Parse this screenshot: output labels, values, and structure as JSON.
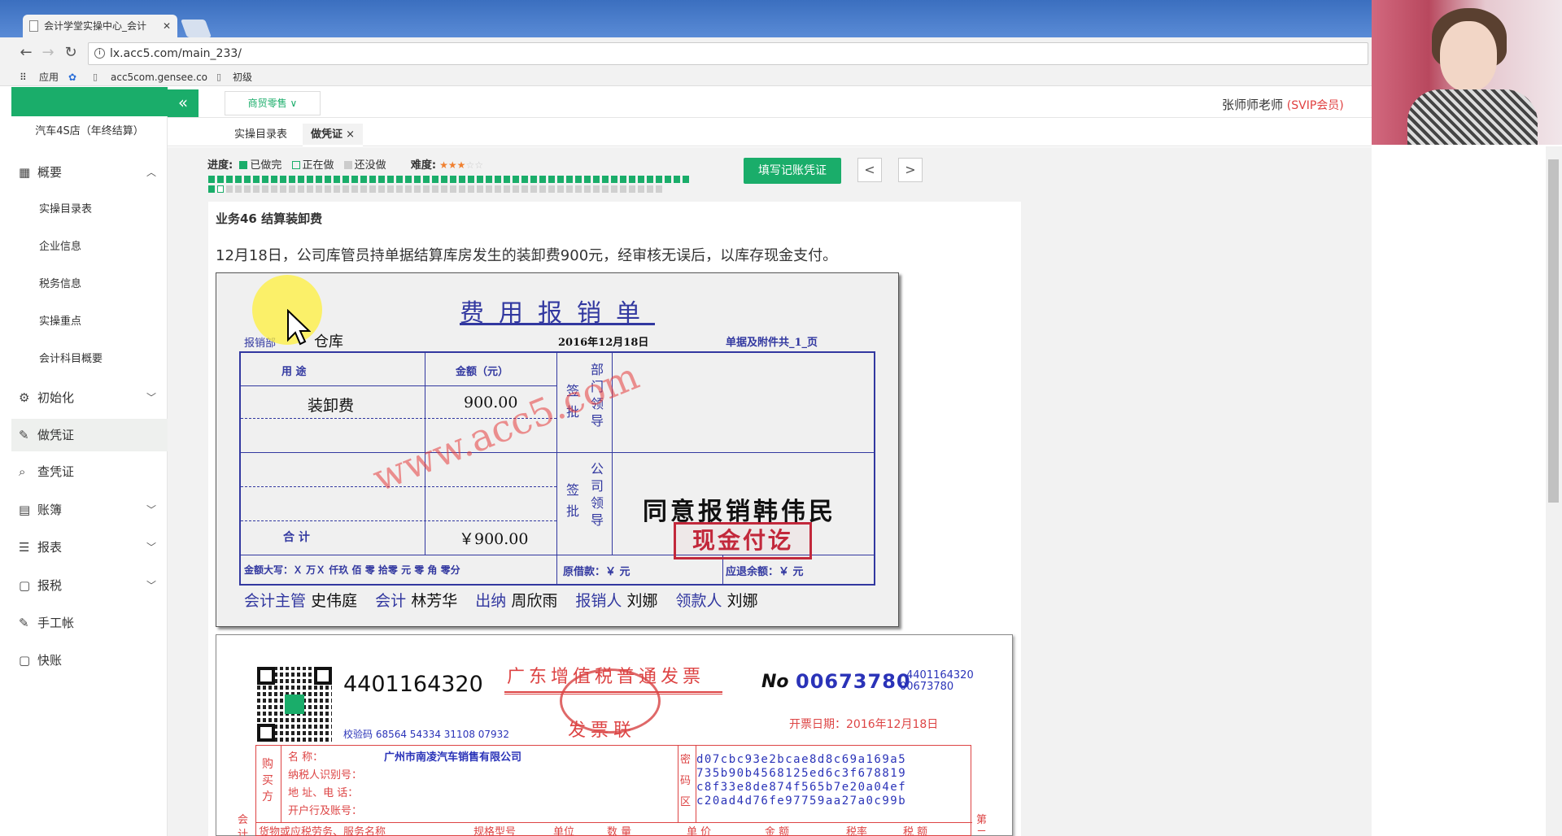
{
  "browser": {
    "tab_title": "会计学堂实操中心_会计",
    "tab_close": "✕",
    "url": "lx.acc5.com/main_233/",
    "bookmarks": [
      "应用",
      "acc5com.gensee.co",
      "初级"
    ]
  },
  "sidebar": {
    "company": "汽车4S店（年终结算）",
    "collapse_icon": "«",
    "items": [
      {
        "label": "概要",
        "icon": "grid-icon",
        "arrow": "up"
      },
      {
        "label": "实操目录表"
      },
      {
        "label": "企业信息"
      },
      {
        "label": "税务信息"
      },
      {
        "label": "实操重点"
      },
      {
        "label": "会计科目概要"
      },
      {
        "label": "初始化",
        "icon": "gear-icon",
        "arrow": "down"
      },
      {
        "label": "做凭证",
        "icon": "pen-icon",
        "active": true
      },
      {
        "label": "查凭证",
        "icon": "search-icon"
      },
      {
        "label": "账簿",
        "icon": "book-icon",
        "arrow": "down"
      },
      {
        "label": "报表",
        "icon": "list-icon",
        "arrow": "down"
      },
      {
        "label": "报税",
        "icon": "doc-icon",
        "arrow": "down"
      },
      {
        "label": "手工帐",
        "icon": "pen-icon"
      },
      {
        "label": "快账",
        "icon": "doc-icon"
      }
    ]
  },
  "header": {
    "shop_type": "商贸零售",
    "user_name": "张师师老师",
    "user_level": "(SVIP会员)"
  },
  "tabs": [
    {
      "label": "实操目录表"
    },
    {
      "label": "做凭证",
      "close": "×"
    }
  ],
  "progress": {
    "label": "进度:",
    "done": "已做完",
    "doing": "正在做",
    "todo": "还没做",
    "difficulty_label": "难度:",
    "difficulty_stars": 3,
    "fill_button": "填写记账凭证",
    "prev": "<",
    "next": ">",
    "done_color": "#1aad6a"
  },
  "business": {
    "title": "业务46 结算装卸费",
    "description": "12月18日，公司库管员持单据结算库房发生的装卸费900元，经审核无误后，以库存现金支付。"
  },
  "expense_voucher": {
    "title": "费用报销单",
    "dept_label": "报销部",
    "dept": "仓库",
    "date": "2016年12月18日",
    "attachments": "单据及附件共_1_页",
    "col_use": "用          途",
    "col_amount": "金额（元）",
    "dept_leader": "部门领导",
    "dept_sign": "签批",
    "company_leader": "公司领导",
    "company_sign": "签批",
    "row1_use": "装卸费",
    "row1_amount": "900.00",
    "total_label": "合          计",
    "total_amount": "￥900.00",
    "capital_amount": "金额大写：Ｘ 万Ｘ 仟玖 佰 零 拾零 元 零 角 零分",
    "original_loan": "原借款：￥      元",
    "refund": "应退余额：￥      元",
    "approval_note": "同意报销韩伟民",
    "stamp": "现金付讫",
    "watermark": "www.acc5.com",
    "signatures": [
      {
        "role": "会计主管",
        "name": "史伟庭"
      },
      {
        "role": "会计",
        "name": "林芳华"
      },
      {
        "role": "出纳",
        "name": "周欣雨"
      },
      {
        "role": "报销人",
        "name": "刘娜"
      },
      {
        "role": "领款人",
        "name": "刘娜"
      }
    ]
  },
  "invoice": {
    "code": "4401164320",
    "title": "广东增值税普通发票",
    "copy": "发票联",
    "no_label": "No",
    "number": "00673780",
    "code_small": "4401164320",
    "number_small": "00673780",
    "check_code": "校验码 68564 54334 31108 07932",
    "issue_date": "开票日期：2016年12月18日",
    "buyer_side": "购买方",
    "buyer_name_label": "名          称：",
    "buyer_name": "广州市南凌汽车销售有限公司",
    "taxpayer_label": "纳税人识别号：",
    "address_label": "地  址、电  话：",
    "bank_label": "开户行及账号：",
    "cipher_side": "密码区",
    "cipher": [
      "d07cbc93e2bcae8d8c69a169a5",
      "735b90b4568125ed6c3f678819",
      "c8f33e8de874f565b7e20a04ef",
      "c20ad4d76fe97759aa27a0c99b"
    ],
    "item_headers": [
      "货物或应税劳务、服务名称",
      "规格型号",
      "单位",
      "数 量",
      "单 价",
      "金 额",
      "税率",
      "税 额"
    ],
    "side_left": "会计",
    "side_right": "第二"
  }
}
